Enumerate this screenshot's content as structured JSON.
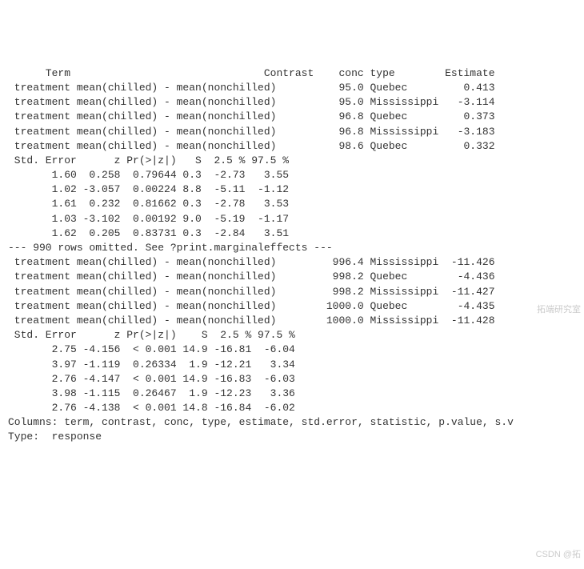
{
  "header1": [
    "Term",
    "Contrast",
    "conc",
    "type",
    "Estimate"
  ],
  "rows1": [
    {
      "term": "treatment",
      "contrast": "mean(chilled) - mean(nonchilled)",
      "conc": "95.0",
      "type": "Quebec",
      "estimate": "0.413"
    },
    {
      "term": "treatment",
      "contrast": "mean(chilled) - mean(nonchilled)",
      "conc": "95.0",
      "type": "Mississippi",
      "estimate": "-3.114"
    },
    {
      "term": "treatment",
      "contrast": "mean(chilled) - mean(nonchilled)",
      "conc": "96.8",
      "type": "Quebec",
      "estimate": "0.373"
    },
    {
      "term": "treatment",
      "contrast": "mean(chilled) - mean(nonchilled)",
      "conc": "96.8",
      "type": "Mississippi",
      "estimate": "-3.183"
    },
    {
      "term": "treatment",
      "contrast": "mean(chilled) - mean(nonchilled)",
      "conc": "98.6",
      "type": "Quebec",
      "estimate": "0.332"
    }
  ],
  "header2": [
    "Std. Error",
    "z",
    "Pr(>|z|)",
    "S",
    "2.5 %",
    "97.5 %"
  ],
  "stats1": [
    {
      "se": "1.60",
      "z": "0.258",
      "p": "0.79644",
      "s": "0.3",
      "lo": "-2.73",
      "hi": "3.55"
    },
    {
      "se": "1.02",
      "z": "-3.057",
      "p": "0.00224",
      "s": "8.8",
      "lo": "-5.11",
      "hi": "-1.12"
    },
    {
      "se": "1.61",
      "z": "0.232",
      "p": "0.81662",
      "s": "0.3",
      "lo": "-2.78",
      "hi": "3.53"
    },
    {
      "se": "1.03",
      "z": "-3.102",
      "p": "0.00192",
      "s": "9.0",
      "lo": "-5.19",
      "hi": "-1.17"
    },
    {
      "se": "1.62",
      "z": "0.205",
      "p": "0.83731",
      "s": "0.3",
      "lo": "-2.84",
      "hi": "3.51"
    }
  ],
  "omitted": "--- 990 rows omitted. See ?print.marginaleffects ---",
  "rows2": [
    {
      "term": "treatment",
      "contrast": "mean(chilled) - mean(nonchilled)",
      "conc": "996.4",
      "type": "Mississippi",
      "estimate": "-11.426"
    },
    {
      "term": "treatment",
      "contrast": "mean(chilled) - mean(nonchilled)",
      "conc": "998.2",
      "type": "Quebec",
      "estimate": "-4.436"
    },
    {
      "term": "treatment",
      "contrast": "mean(chilled) - mean(nonchilled)",
      "conc": "998.2",
      "type": "Mississippi",
      "estimate": "-11.427"
    },
    {
      "term": "treatment",
      "contrast": "mean(chilled) - mean(nonchilled)",
      "conc": "1000.0",
      "type": "Quebec",
      "estimate": "-4.435"
    },
    {
      "term": "treatment",
      "contrast": "mean(chilled) - mean(nonchilled)",
      "conc": "1000.0",
      "type": "Mississippi",
      "estimate": "-11.428"
    }
  ],
  "stats2": [
    {
      "se": "2.75",
      "z": "-4.156",
      "p": "< 0.001",
      "s": "14.9",
      "lo": "-16.81",
      "hi": "-6.04"
    },
    {
      "se": "3.97",
      "z": "-1.119",
      "p": "0.26334",
      "s": "1.9",
      "lo": "-12.21",
      "hi": "3.34"
    },
    {
      "se": "2.76",
      "z": "-4.147",
      "p": "< 0.001",
      "s": "14.9",
      "lo": "-16.83",
      "hi": "-6.03"
    },
    {
      "se": "3.98",
      "z": "-1.115",
      "p": "0.26467",
      "s": "1.9",
      "lo": "-12.23",
      "hi": "3.36"
    },
    {
      "se": "2.76",
      "z": "-4.138",
      "p": "< 0.001",
      "s": "14.8",
      "lo": "-16.84",
      "hi": "-6.02"
    }
  ],
  "columns_line": "Columns: term, contrast, conc, type, estimate, std.error, statistic, p.value, s.v",
  "type_line": "Type:  response",
  "watermark1": "拓端研究室",
  "watermark2": "CSDN @拓"
}
